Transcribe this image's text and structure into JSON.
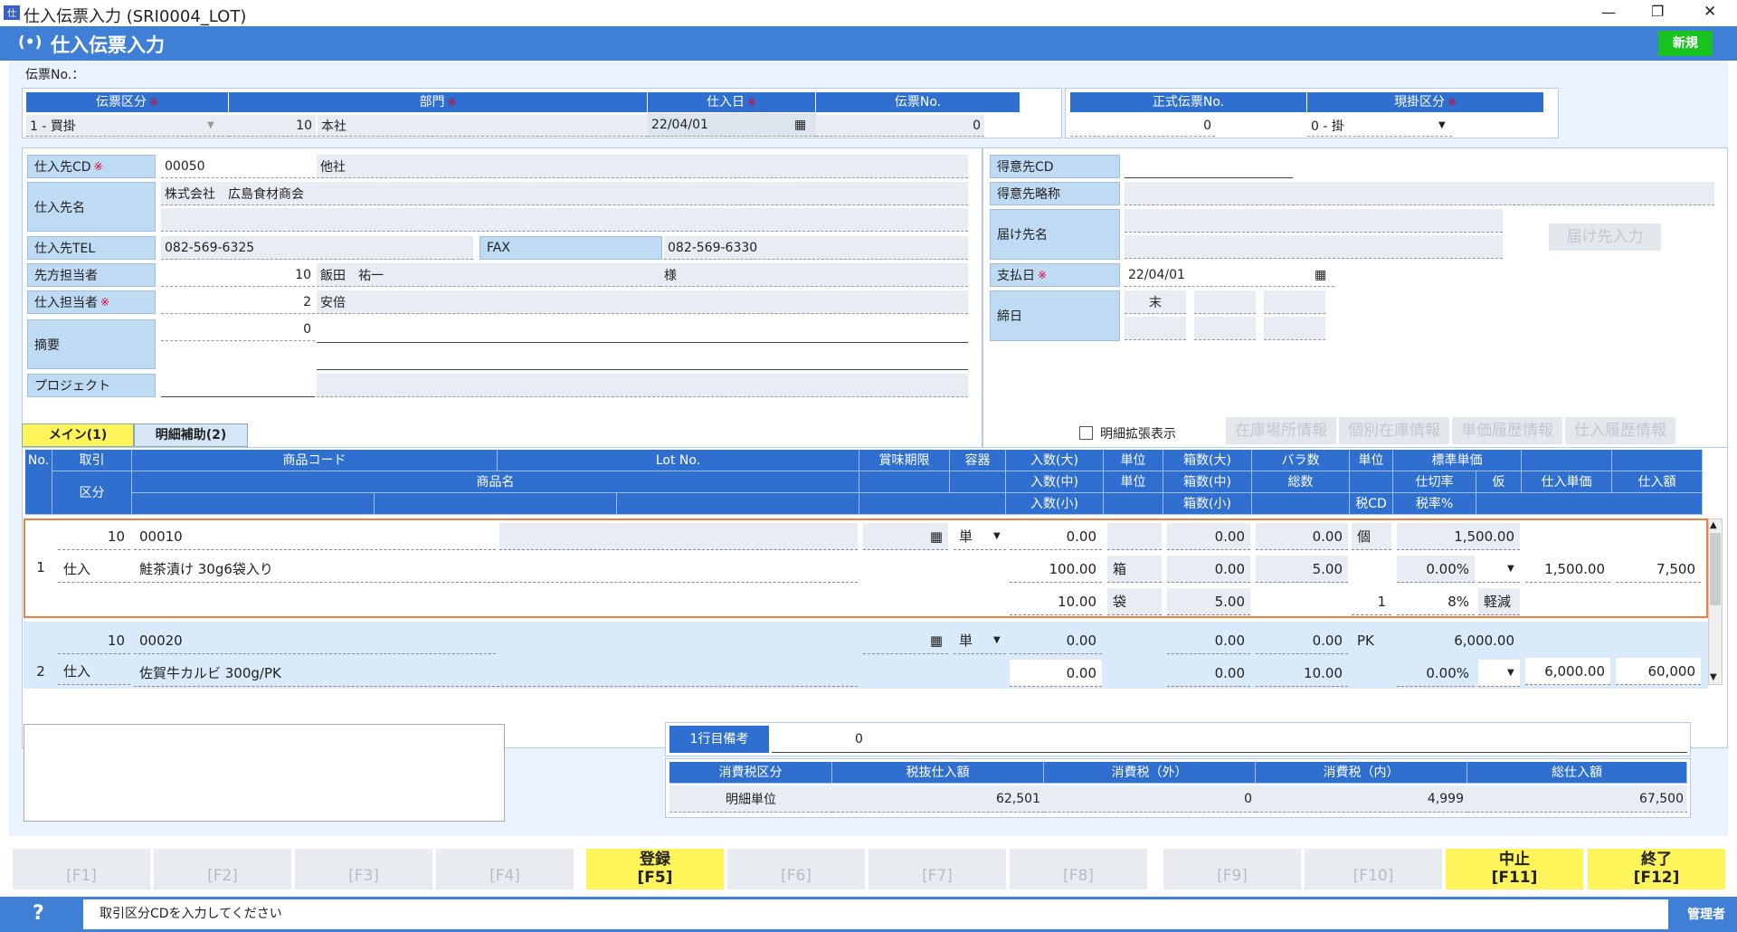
{
  "window": {
    "title": "仕入伝票入力 (SRI0004_LOT)",
    "minimize": "—",
    "restore": "❐",
    "close": "✕"
  },
  "app": {
    "title": "仕入伝票入力",
    "mode_badge": "新規"
  },
  "header": {
    "denpyo_no_label": "伝票No.：",
    "cols": [
      "伝票区分",
      "部門",
      "仕入日",
      "伝票No."
    ],
    "denpyo_kubun": "1 - 買掛",
    "bumon_cd": "10",
    "bumon_name": "本社",
    "shiire_date": "22/04/01",
    "denpyo_no": "0",
    "cols2": [
      "正式伝票No.",
      "現掛区分"
    ],
    "seishiki_no": "0",
    "genkake": "0 - 掛"
  },
  "supplier": {
    "cd_label": "仕入先CD",
    "cd": "00050",
    "cd_extra": "他社",
    "name_label": "仕入先名",
    "name": "株式会社　広島食材商会",
    "tel_label": "仕入先TEL",
    "tel": "082-569-6325",
    "fax_label": "FAX",
    "fax": "082-569-6330",
    "contact_label": "先方担当者",
    "contact_cd": "10",
    "contact_name": "飯田　祐一",
    "contact_suffix": "様",
    "staff_label": "仕入担当者",
    "staff_cd": "2",
    "staff_name": "安倍",
    "memo_label": "摘要",
    "memo_cd": "0",
    "project_label": "プロジェクト"
  },
  "customer": {
    "cd_label": "得意先CD",
    "short_label": "得意先略称",
    "dest_label": "届け先名",
    "dest_button": "届け先入力",
    "pay_label": "支払日",
    "pay_date": "22/04/01",
    "close_label": "締日",
    "close_val": "末"
  },
  "tabs": {
    "main": "メイン(1)",
    "sub": "明細補助(2)",
    "expand": "明細拡張表示",
    "buttons": [
      "在庫場所情報",
      "個別在庫情報",
      "単価履歴情報",
      "仕入履歴情報"
    ]
  },
  "grid": {
    "h_no": "No.",
    "h_torihiki": "取引",
    "h_kubun": "区分",
    "h_code": "商品コード",
    "h_lot": "Lot No.",
    "h_name": "商品名",
    "h_expire": "賞味期限",
    "h_container": "容器",
    "h_in_l": "入数(大)",
    "h_in_m": "入数(中)",
    "h_in_s": "入数(小)",
    "h_unit": "単位",
    "h_box_l": "箱数(大)",
    "h_box_m": "箱数(中)",
    "h_box_s": "箱数(小)",
    "h_bara": "バラ数",
    "h_total": "総数",
    "h_unit2": "単位",
    "h_taxcd": "税CD",
    "h_std": "標準単価",
    "h_rate": "仕切率",
    "h_taxrate": "税率%",
    "h_kari": "仮",
    "h_price": "仕入単価",
    "h_amount": "仕入額",
    "rows": [
      {
        "no": "1",
        "torihiki_cd": "10",
        "torihiki": "仕入",
        "code": "00010",
        "name": "鮭茶漬け 30g6袋入り",
        "container": "単",
        "in_l": "0.00",
        "in_m": "100.00",
        "in_s": "10.00",
        "unit_m": "箱",
        "unit_s": "袋",
        "box_l": "0.00",
        "box_m": "0.00",
        "box_s": "5.00",
        "bara": "0.00",
        "total": "5.00",
        "unit2": "個",
        "taxcd": "1",
        "std": "1,500.00",
        "rate": "0.00%",
        "taxrate": "8%",
        "kari": "軽減",
        "price": "1,500.00",
        "amount": "7,500"
      },
      {
        "no": "2",
        "torihiki_cd": "10",
        "torihiki": "仕入",
        "code": "00020",
        "name": "佐賀牛カルビ 300g/PK",
        "container": "単",
        "in_l": "0.00",
        "in_m": "0.00",
        "box_l": "0.00",
        "box_m": "0.00",
        "bara": "0.00",
        "total": "10.00",
        "unit2": "PK",
        "std": "6,000.00",
        "rate": "0.00%",
        "price": "6,000.00",
        "amount": "60,000"
      }
    ]
  },
  "footer": {
    "note_label": "1行目備考",
    "note_val": "0",
    "sum_headers": [
      "消費税区分",
      "税抜仕入額",
      "消費税（外）",
      "消費税（内）",
      "総仕入額"
    ],
    "sum_row": [
      "明細単位",
      "62,501",
      "0",
      "4,999",
      "67,500"
    ]
  },
  "fkeys": [
    {
      "l": "[F1]"
    },
    {
      "l": "[F2]"
    },
    {
      "l": "[F3]"
    },
    {
      "l": "[F4]"
    },
    {
      "t": "登録",
      "l": "[F5]"
    },
    {
      "l": "[F6]"
    },
    {
      "l": "[F7]"
    },
    {
      "l": "[F8]"
    },
    {
      "l": "[F9]"
    },
    {
      "l": "[F10]"
    },
    {
      "t": "中止",
      "l": "[F11]"
    },
    {
      "t": "終了",
      "l": "[F12]"
    }
  ],
  "status": {
    "help": "?",
    "message": "取引区分CDを入力してください",
    "user": "管理者"
  },
  "colors": {
    "accent": "#3f7fd6",
    "header": "#2f6fcf",
    "label": "#bfdaf3",
    "highlight": "#fff45a",
    "active_border": "#f08040"
  }
}
